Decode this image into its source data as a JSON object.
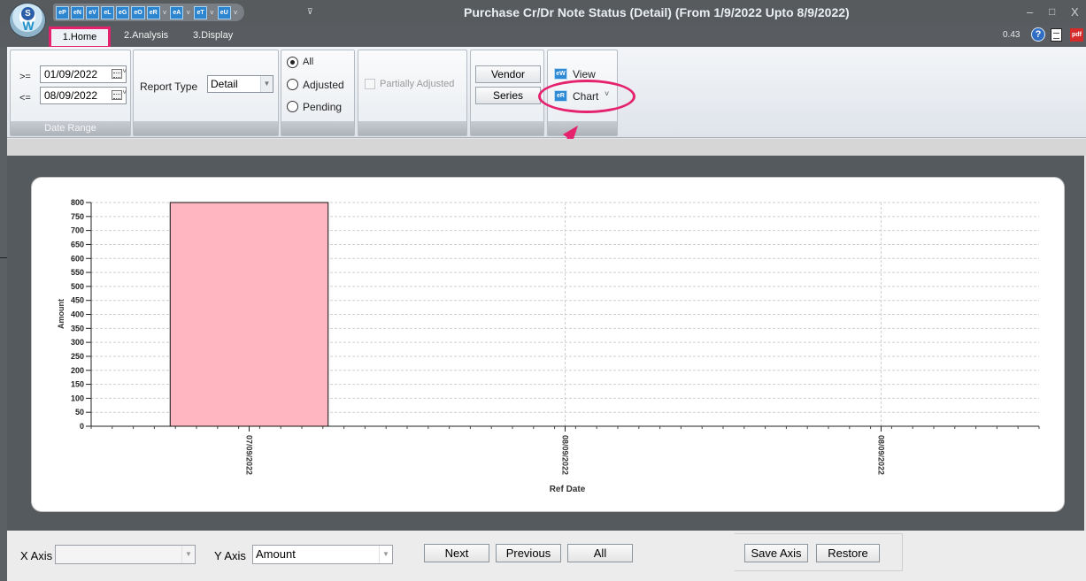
{
  "window": {
    "title": "Purchase Cr/Dr Note Status (Detail)  (From 1/9/2022 Upto 8/9/2022)",
    "minimize": "–",
    "maximize": "□",
    "close": "X"
  },
  "quick_access": [
    {
      "label": "eP",
      "dropdown": false
    },
    {
      "label": "eN",
      "dropdown": false
    },
    {
      "label": "eV",
      "dropdown": false
    },
    {
      "label": "eL",
      "dropdown": false
    },
    {
      "label": "eG",
      "dropdown": false
    },
    {
      "label": "eO",
      "dropdown": false
    },
    {
      "label": "eR",
      "dropdown": true
    },
    {
      "label": "eA",
      "dropdown": true
    },
    {
      "label": "eT",
      "dropdown": true
    },
    {
      "label": "eU",
      "dropdown": true
    }
  ],
  "quick_access_more": "⊽",
  "tabs": [
    "1.Home",
    "2.Analysis",
    "3.Display"
  ],
  "version": "0.43",
  "help_icon": "?",
  "pdf_icon": "pdf",
  "ribbon": {
    "date_range": {
      "from_prefix": ">=",
      "from_value": "01/09/2022",
      "to_prefix": "<=",
      "to_value": "08/09/2022",
      "footer": "Date Range"
    },
    "report_type": {
      "label": "Report Type",
      "value": "Detail"
    },
    "status_options": [
      {
        "label": "All",
        "selected": true
      },
      {
        "label": "Adjusted",
        "selected": false
      },
      {
        "label": "Pending",
        "selected": false
      }
    ],
    "partially_adjusted": {
      "label": "Partially Adjusted",
      "checked": false,
      "enabled": false
    },
    "vendor_button": "Vendor",
    "series_button": "Series",
    "view_button": {
      "label": "View",
      "icon": "eW"
    },
    "chart_button": {
      "label": "Chart",
      "icon": "eR",
      "caret": "˅"
    }
  },
  "colors": {
    "annotation": "#e5226e",
    "bar_fill": "#ffb6c1"
  },
  "chart_data": {
    "type": "bar",
    "categories": [
      "07/09/2022",
      "08/09/2022",
      "08/09/2022"
    ],
    "values": [
      800,
      0,
      0
    ],
    "xlabel": "Ref Date",
    "ylabel": "Amount",
    "ylim": [
      0,
      800
    ],
    "yticks": [
      0,
      50,
      100,
      150,
      200,
      250,
      300,
      350,
      400,
      450,
      500,
      550,
      600,
      650,
      700,
      750,
      800
    ],
    "grid": true
  },
  "bottom": {
    "x_axis_label": "X Axis",
    "x_axis_value": "",
    "y_axis_label": "Y Axis",
    "y_axis_value": "Amount",
    "next_button": "Next",
    "previous_button": "Previous",
    "all_button": "All",
    "save_axis_button": "Save Axis",
    "restore_button": "Restore"
  }
}
